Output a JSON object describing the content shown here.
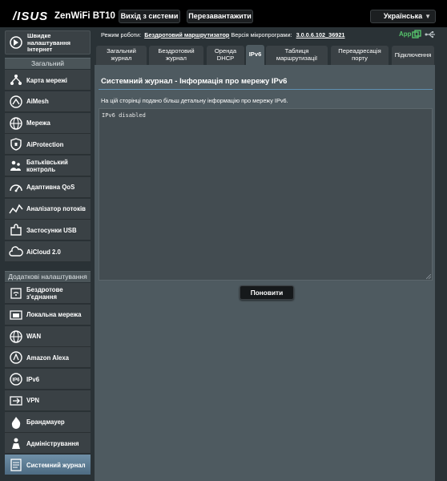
{
  "header": {
    "brand": "/ISUS",
    "model": "ZenWiFi BT10",
    "logout_label": "Вихід з системи",
    "reboot_label": "Перезавантажити",
    "language": "Українська"
  },
  "status": {
    "mode_label": "Режим роботи:",
    "mode_value": "Бездротовий маршрутизатор",
    "firmware_label": "Версія мікропрограми:",
    "firmware_value": "3.0.0.6.102_36921",
    "app_label": "App"
  },
  "sidebar": {
    "quick_setup": "Швидке налаштування Інтернет",
    "general_header": "Загальний",
    "general_items": [
      {
        "label": "Карта мережі",
        "icon": "network-map-icon"
      },
      {
        "label": "AiMesh",
        "icon": "aimesh-icon"
      },
      {
        "label": "Мережа",
        "icon": "globe-icon"
      },
      {
        "label": "AiProtection",
        "icon": "shield-icon"
      },
      {
        "label": "Батьківський контроль",
        "icon": "parental-control-icon"
      },
      {
        "label": "Адаптивна QoS",
        "icon": "gauge-icon"
      },
      {
        "label": "Аналізатор потоків",
        "icon": "traffic-analyzer-icon"
      },
      {
        "label": "Застосунки USB",
        "icon": "puzzle-icon"
      },
      {
        "label": "AiCloud 2.0",
        "icon": "cloud-icon"
      }
    ],
    "advanced_header": "Додаткові налаштування",
    "advanced_items": [
      {
        "label": "Бездротове з'єднання",
        "icon": "wifi-icon"
      },
      {
        "label": "Локальна мережа",
        "icon": "home-icon"
      },
      {
        "label": "WAN",
        "icon": "globe-icon"
      },
      {
        "label": "Amazon Alexa",
        "icon": "alexa-icon"
      },
      {
        "label": "IPv6",
        "icon": "ipv6-icon"
      },
      {
        "label": "VPN",
        "icon": "vpn-icon"
      },
      {
        "label": "Брандмауер",
        "icon": "firewall-icon"
      },
      {
        "label": "Адміністрування",
        "icon": "admin-icon"
      },
      {
        "label": "Системний журнал",
        "icon": "log-icon",
        "active": true
      }
    ]
  },
  "tabs": [
    {
      "label": "Загальний журнал"
    },
    {
      "label": "Бездротовий журнал"
    },
    {
      "label": "Оренда DHCP"
    },
    {
      "label": "IPv6",
      "active": true
    },
    {
      "label": "Таблиця маршрутизації"
    },
    {
      "label": "Переадресація порту"
    },
    {
      "label": "Підключення"
    }
  ],
  "main": {
    "title": "Системний журнал - Інформація про мережу IPv6",
    "description": "На цій сторінці подано більш детальну інформацію про мережу IPv6.",
    "log_text": "IPv6 disabled",
    "refresh_label": "Поновити"
  },
  "colors": {
    "accent": "#5f8fb0",
    "app_status": "#56c26b",
    "active_nav": "#5f7f97"
  }
}
